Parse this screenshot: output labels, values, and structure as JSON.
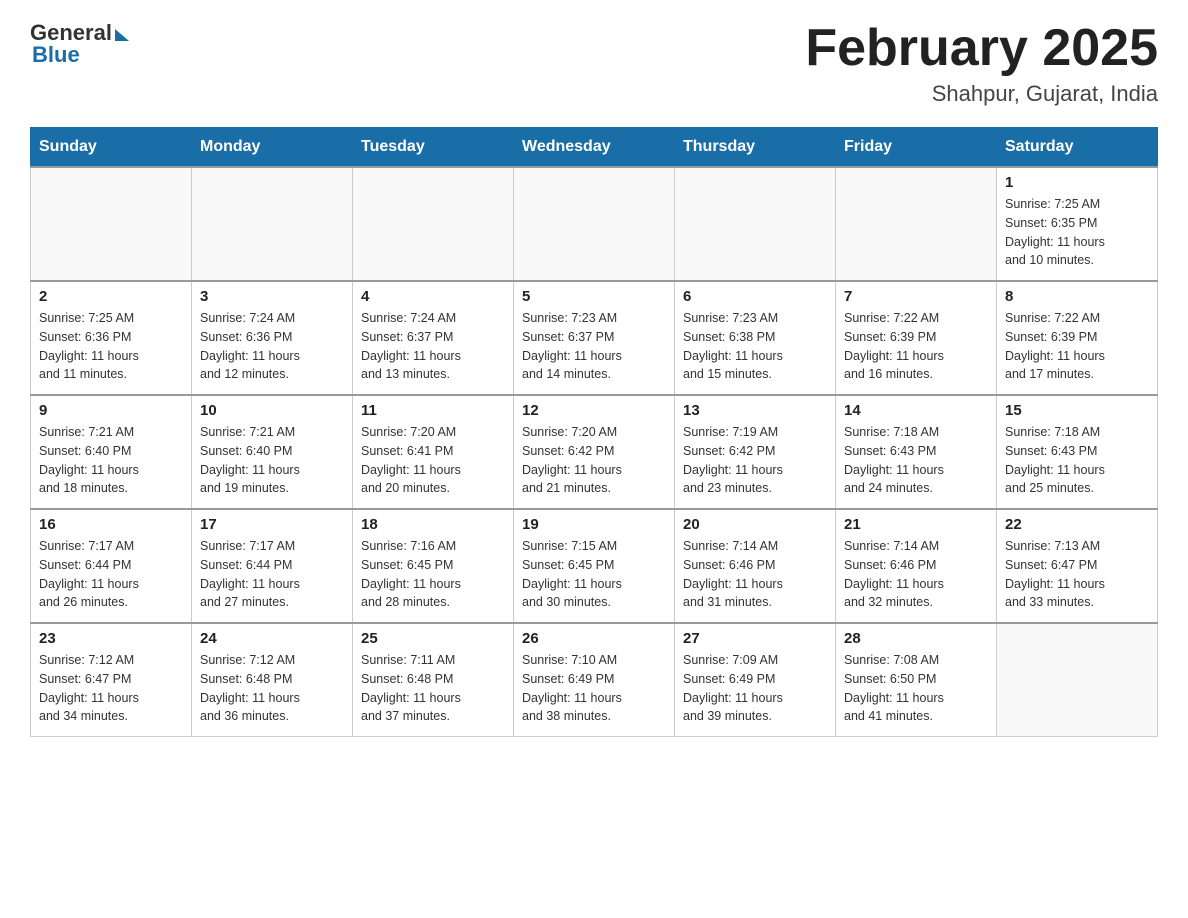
{
  "header": {
    "logo_general": "General",
    "logo_blue": "Blue",
    "month_title": "February 2025",
    "location": "Shahpur, Gujarat, India"
  },
  "weekdays": [
    "Sunday",
    "Monday",
    "Tuesday",
    "Wednesday",
    "Thursday",
    "Friday",
    "Saturday"
  ],
  "weeks": [
    [
      {
        "day": "",
        "info": ""
      },
      {
        "day": "",
        "info": ""
      },
      {
        "day": "",
        "info": ""
      },
      {
        "day": "",
        "info": ""
      },
      {
        "day": "",
        "info": ""
      },
      {
        "day": "",
        "info": ""
      },
      {
        "day": "1",
        "info": "Sunrise: 7:25 AM\nSunset: 6:35 PM\nDaylight: 11 hours\nand 10 minutes."
      }
    ],
    [
      {
        "day": "2",
        "info": "Sunrise: 7:25 AM\nSunset: 6:36 PM\nDaylight: 11 hours\nand 11 minutes."
      },
      {
        "day": "3",
        "info": "Sunrise: 7:24 AM\nSunset: 6:36 PM\nDaylight: 11 hours\nand 12 minutes."
      },
      {
        "day": "4",
        "info": "Sunrise: 7:24 AM\nSunset: 6:37 PM\nDaylight: 11 hours\nand 13 minutes."
      },
      {
        "day": "5",
        "info": "Sunrise: 7:23 AM\nSunset: 6:37 PM\nDaylight: 11 hours\nand 14 minutes."
      },
      {
        "day": "6",
        "info": "Sunrise: 7:23 AM\nSunset: 6:38 PM\nDaylight: 11 hours\nand 15 minutes."
      },
      {
        "day": "7",
        "info": "Sunrise: 7:22 AM\nSunset: 6:39 PM\nDaylight: 11 hours\nand 16 minutes."
      },
      {
        "day": "8",
        "info": "Sunrise: 7:22 AM\nSunset: 6:39 PM\nDaylight: 11 hours\nand 17 minutes."
      }
    ],
    [
      {
        "day": "9",
        "info": "Sunrise: 7:21 AM\nSunset: 6:40 PM\nDaylight: 11 hours\nand 18 minutes."
      },
      {
        "day": "10",
        "info": "Sunrise: 7:21 AM\nSunset: 6:40 PM\nDaylight: 11 hours\nand 19 minutes."
      },
      {
        "day": "11",
        "info": "Sunrise: 7:20 AM\nSunset: 6:41 PM\nDaylight: 11 hours\nand 20 minutes."
      },
      {
        "day": "12",
        "info": "Sunrise: 7:20 AM\nSunset: 6:42 PM\nDaylight: 11 hours\nand 21 minutes."
      },
      {
        "day": "13",
        "info": "Sunrise: 7:19 AM\nSunset: 6:42 PM\nDaylight: 11 hours\nand 23 minutes."
      },
      {
        "day": "14",
        "info": "Sunrise: 7:18 AM\nSunset: 6:43 PM\nDaylight: 11 hours\nand 24 minutes."
      },
      {
        "day": "15",
        "info": "Sunrise: 7:18 AM\nSunset: 6:43 PM\nDaylight: 11 hours\nand 25 minutes."
      }
    ],
    [
      {
        "day": "16",
        "info": "Sunrise: 7:17 AM\nSunset: 6:44 PM\nDaylight: 11 hours\nand 26 minutes."
      },
      {
        "day": "17",
        "info": "Sunrise: 7:17 AM\nSunset: 6:44 PM\nDaylight: 11 hours\nand 27 minutes."
      },
      {
        "day": "18",
        "info": "Sunrise: 7:16 AM\nSunset: 6:45 PM\nDaylight: 11 hours\nand 28 minutes."
      },
      {
        "day": "19",
        "info": "Sunrise: 7:15 AM\nSunset: 6:45 PM\nDaylight: 11 hours\nand 30 minutes."
      },
      {
        "day": "20",
        "info": "Sunrise: 7:14 AM\nSunset: 6:46 PM\nDaylight: 11 hours\nand 31 minutes."
      },
      {
        "day": "21",
        "info": "Sunrise: 7:14 AM\nSunset: 6:46 PM\nDaylight: 11 hours\nand 32 minutes."
      },
      {
        "day": "22",
        "info": "Sunrise: 7:13 AM\nSunset: 6:47 PM\nDaylight: 11 hours\nand 33 minutes."
      }
    ],
    [
      {
        "day": "23",
        "info": "Sunrise: 7:12 AM\nSunset: 6:47 PM\nDaylight: 11 hours\nand 34 minutes."
      },
      {
        "day": "24",
        "info": "Sunrise: 7:12 AM\nSunset: 6:48 PM\nDaylight: 11 hours\nand 36 minutes."
      },
      {
        "day": "25",
        "info": "Sunrise: 7:11 AM\nSunset: 6:48 PM\nDaylight: 11 hours\nand 37 minutes."
      },
      {
        "day": "26",
        "info": "Sunrise: 7:10 AM\nSunset: 6:49 PM\nDaylight: 11 hours\nand 38 minutes."
      },
      {
        "day": "27",
        "info": "Sunrise: 7:09 AM\nSunset: 6:49 PM\nDaylight: 11 hours\nand 39 minutes."
      },
      {
        "day": "28",
        "info": "Sunrise: 7:08 AM\nSunset: 6:50 PM\nDaylight: 11 hours\nand 41 minutes."
      },
      {
        "day": "",
        "info": ""
      }
    ]
  ]
}
